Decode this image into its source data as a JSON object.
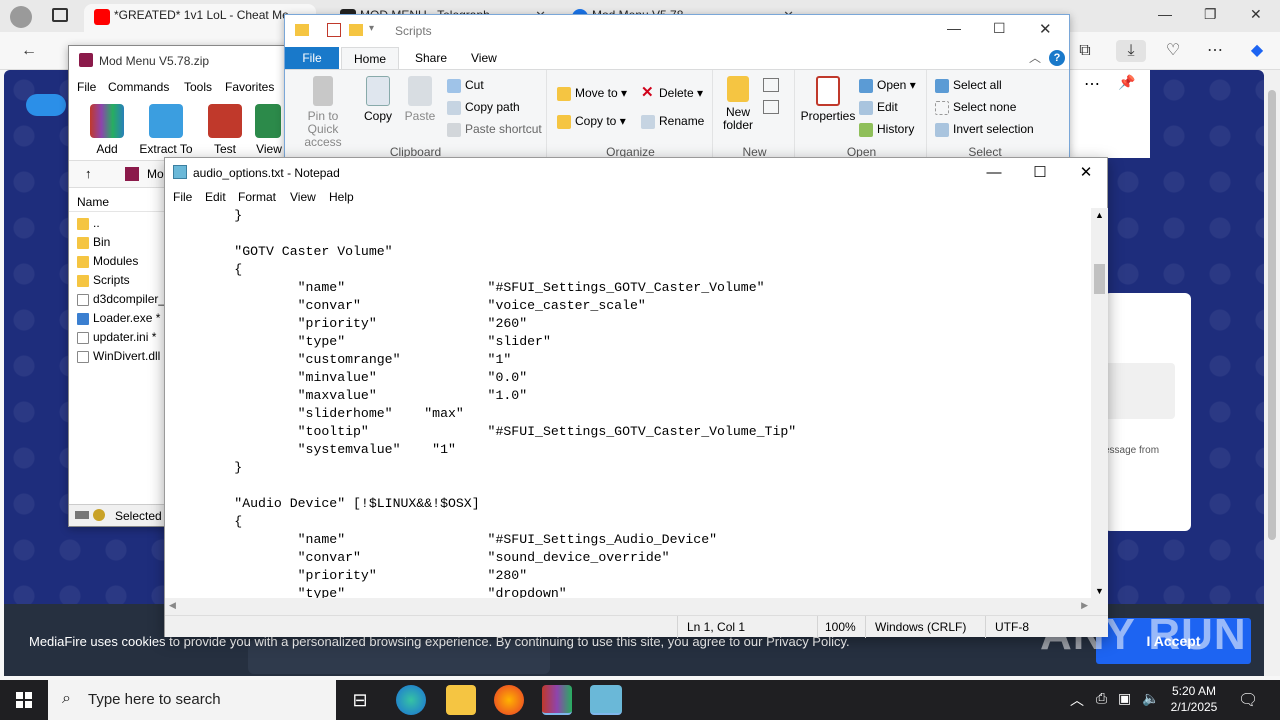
{
  "browser": {
    "tabs": [
      {
        "title": "*GREATED* 1v1 LoL - Cheat Me",
        "favicon_color": "#ff0000"
      },
      {
        "title": "MOD MENU - Telegraph",
        "favicon_color": "#222222"
      },
      {
        "title": "Mod Menu V5.78",
        "favicon_color": "#1a73e8"
      }
    ],
    "cookie_text": "MediaFire uses cookies to provide you with a personalized browsing experience. By continuing to use this site, you agree to our Privacy Policy.",
    "accept_label": "I Accept",
    "dialog_partial_text": "essage from",
    "watermark": "ANY RUN"
  },
  "winrar": {
    "title": "Mod Menu V5.78.zip",
    "menu": [
      "File",
      "Commands",
      "Tools",
      "Favorites"
    ],
    "toolbar": [
      "Add",
      "Extract To",
      "Test",
      "View"
    ],
    "path_partial": "Mo",
    "column_name": "Name",
    "files": [
      "..",
      "Bin",
      "Modules",
      "Scripts",
      "d3dcompiler_",
      "Loader.exe *",
      "updater.ini *",
      "WinDivert.dll"
    ],
    "status": "Selected"
  },
  "explorer": {
    "title": "Scripts",
    "tabs": [
      "File",
      "Home",
      "Share",
      "View"
    ],
    "clipboard": {
      "pin": "Pin to Quick access",
      "copy": "Copy",
      "paste": "Paste",
      "cut": "Cut",
      "copy_path": "Copy path",
      "paste_shortcut": "Paste shortcut",
      "label": "Clipboard"
    },
    "organize": {
      "move_to": "Move to",
      "copy_to": "Copy to",
      "delete": "Delete",
      "rename": "Rename",
      "label": "Organize"
    },
    "new": {
      "new_folder": "New folder",
      "label": "New"
    },
    "open": {
      "properties": "Properties",
      "open": "Open",
      "edit": "Edit",
      "history": "History",
      "label": "Open"
    },
    "select": {
      "select_all": "Select all",
      "select_none": "Select none",
      "invert": "Invert selection",
      "label": "Select"
    }
  },
  "notepad": {
    "title": "audio_options.txt - Notepad",
    "menu": [
      "File",
      "Edit",
      "Format",
      "View",
      "Help"
    ],
    "content": "        }\n\n        \"GOTV Caster Volume\"\n        {\n                \"name\"                  \"#SFUI_Settings_GOTV_Caster_Volume\"\n                \"convar\"                \"voice_caster_scale\"\n                \"priority\"              \"260\"\n                \"type\"                  \"slider\"\n                \"customrange\"           \"1\"\n                \"minvalue\"              \"0.0\"\n                \"maxvalue\"              \"1.0\"\n                \"sliderhome\"    \"max\"\n                \"tooltip\"               \"#SFUI_Settings_GOTV_Caster_Volume_Tip\"\n                \"systemvalue\"    \"1\"\n        }\n\n        \"Audio Device\" [!$LINUX&&!$OSX]\n        {\n                \"name\"                  \"#SFUI_Settings_Audio_Device\"\n                \"convar\"                \"sound_device_override\"\n                \"priority\"              \"280\"\n                \"type\"                  \"dropdown\"",
    "status": {
      "position": "Ln 1, Col 1",
      "zoom": "100%",
      "eol": "Windows (CRLF)",
      "encoding": "UTF-8"
    }
  },
  "taskbar": {
    "search_placeholder": "Type here to search",
    "time": "5:20 AM",
    "date": "2/1/2025"
  }
}
